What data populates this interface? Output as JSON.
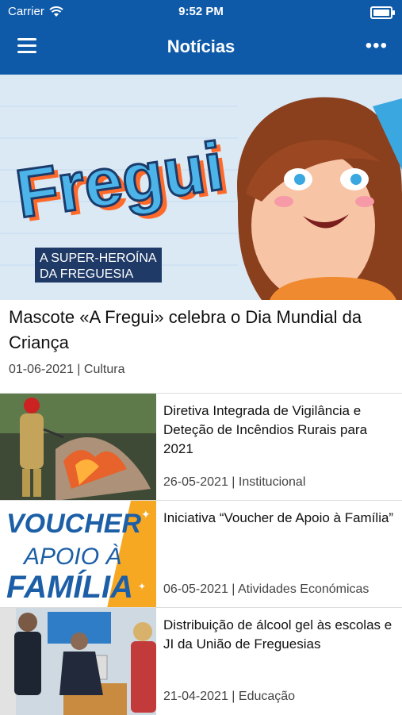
{
  "status_bar": {
    "carrier": "Carrier",
    "time": "9:52 PM"
  },
  "nav": {
    "title": "Notícias"
  },
  "featured": {
    "title": "Mascote «A Fregui» celebra o Dia Mundial da Criança",
    "meta": "01-06-2021 | Cultura",
    "image_text": {
      "logo": "Fregui",
      "tag_line1": "A SUPER-HEROÍNA",
      "tag_line2": "DA FREGUESIA"
    }
  },
  "news": [
    {
      "title": "Diretiva Integrada de Vigilância e Deteção de Incêndios Rurais para 2021",
      "meta": "26-05-2021 | Institucional"
    },
    {
      "title": "Iniciativa “Voucher de Apoio à Família”",
      "meta": "06-05-2021 | Atividades Económicas",
      "image_text": {
        "l1": "VOUCHER",
        "l2": "APOIO À",
        "l3": "FAMÍLIA"
      }
    },
    {
      "title": "Distribuição de álcool gel às escolas e JI da União de Freguesias",
      "meta": "21-04-2021 | Educação"
    }
  ],
  "colors": {
    "header": "#0f5aa8",
    "voucher_blue": "#1c5fa6",
    "voucher_orange": "#f7a823"
  }
}
